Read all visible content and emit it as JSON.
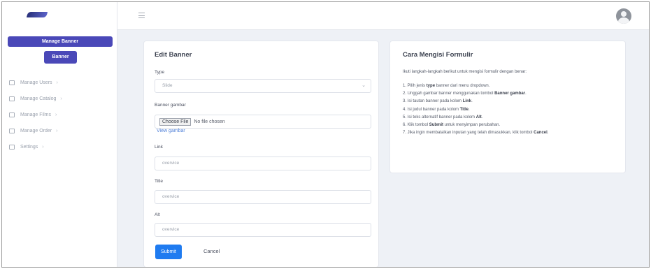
{
  "sidebar": {
    "active_label": "Manage Banner",
    "sub_label": "Banner",
    "items": [
      {
        "label": "Manage Users",
        "icon": "users-icon"
      },
      {
        "label": "Manage Catalog",
        "icon": "catalog-icon"
      },
      {
        "label": "Manage Films",
        "icon": "films-icon"
      },
      {
        "label": "Manage Order",
        "icon": "order-icon"
      },
      {
        "label": "Settings",
        "icon": "settings-icon"
      }
    ]
  },
  "edit": {
    "title": "Edit Banner",
    "type_label": "Type",
    "type_value": "Slide",
    "banner_label": "Banner gambar",
    "file_button": "Choose File",
    "file_status": "No file chosen",
    "view_link": "View gambar",
    "link_label": "Link",
    "link_placeholder": "overvice",
    "title_label": "Title",
    "title_placeholder": "overvice",
    "alt_label": "Alt",
    "alt_placeholder": "overvice",
    "submit": "Submit",
    "cancel": "Cancel"
  },
  "help": {
    "title": "Cara Mengisi Formulir",
    "intro": "Ikuti langkah-langkah berikut untuk mengisi formulir dengan benar:",
    "steps": [
      {
        "pre": "1. Pilih jenis ",
        "bold": "type",
        "post": " banner dari menu dropdown."
      },
      {
        "pre": "2. Unggah gambar banner menggunakan tombol ",
        "bold": "Banner gambar",
        "post": "."
      },
      {
        "pre": "3. Isi tautan banner pada kolom ",
        "bold": "Link",
        "post": "."
      },
      {
        "pre": "4. Isi judul banner pada kolom ",
        "bold": "Title",
        "post": "."
      },
      {
        "pre": "5. Isi teks alternatif banner pada kolom ",
        "bold": "Alt",
        "post": "."
      },
      {
        "pre": "6. Klik tombol ",
        "bold": "Submit",
        "post": " untuk menyimpan perubahan."
      },
      {
        "pre": "7. Jika ingin membatalkan inputan yang telah dimasukkan, klik tombol ",
        "bold": "Cancel",
        "post": "."
      }
    ]
  },
  "colors": {
    "accent": "#4a48b8",
    "primary_button": "#1f7bf0",
    "link": "#4e7fd8"
  }
}
